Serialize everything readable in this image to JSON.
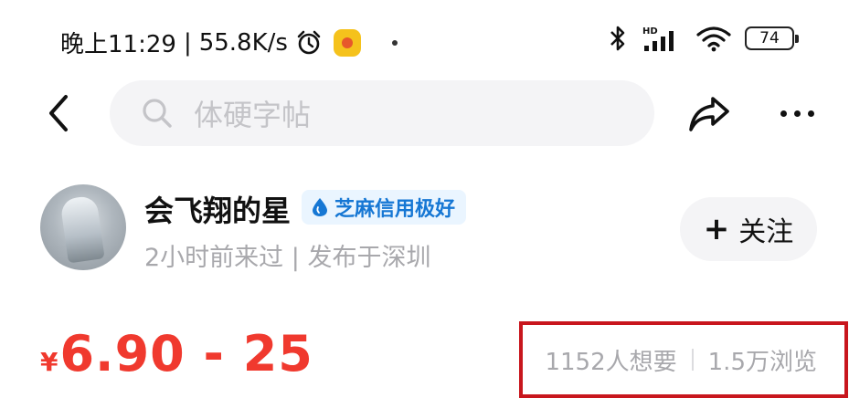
{
  "status_bar": {
    "time": "晚上11:29",
    "separator": "|",
    "network_speed": "55.8K/s",
    "battery_level": "74",
    "icons": [
      "alarm-icon",
      "app-badge-icon",
      "dot-icon",
      "bluetooth-icon",
      "hd-signal-icon",
      "wifi-icon",
      "battery-icon"
    ]
  },
  "nav": {
    "search_placeholder": "体硬字帖",
    "icons": [
      "back-icon",
      "search-icon",
      "share-icon",
      "more-icon"
    ]
  },
  "seller": {
    "name": "会飞翔的星",
    "credit_badge": "芝麻信用极好",
    "meta": "2小时前来过 | 发布于深圳",
    "follow_label": "关注",
    "follow_icon": "plus-icon"
  },
  "price": {
    "currency_symbol": "¥",
    "range": "6.90 - 25",
    "color": "#f0392e"
  },
  "stats": {
    "wants": "1152人想要",
    "views": "1.5万浏览",
    "highlight_color": "#c8161d"
  }
}
